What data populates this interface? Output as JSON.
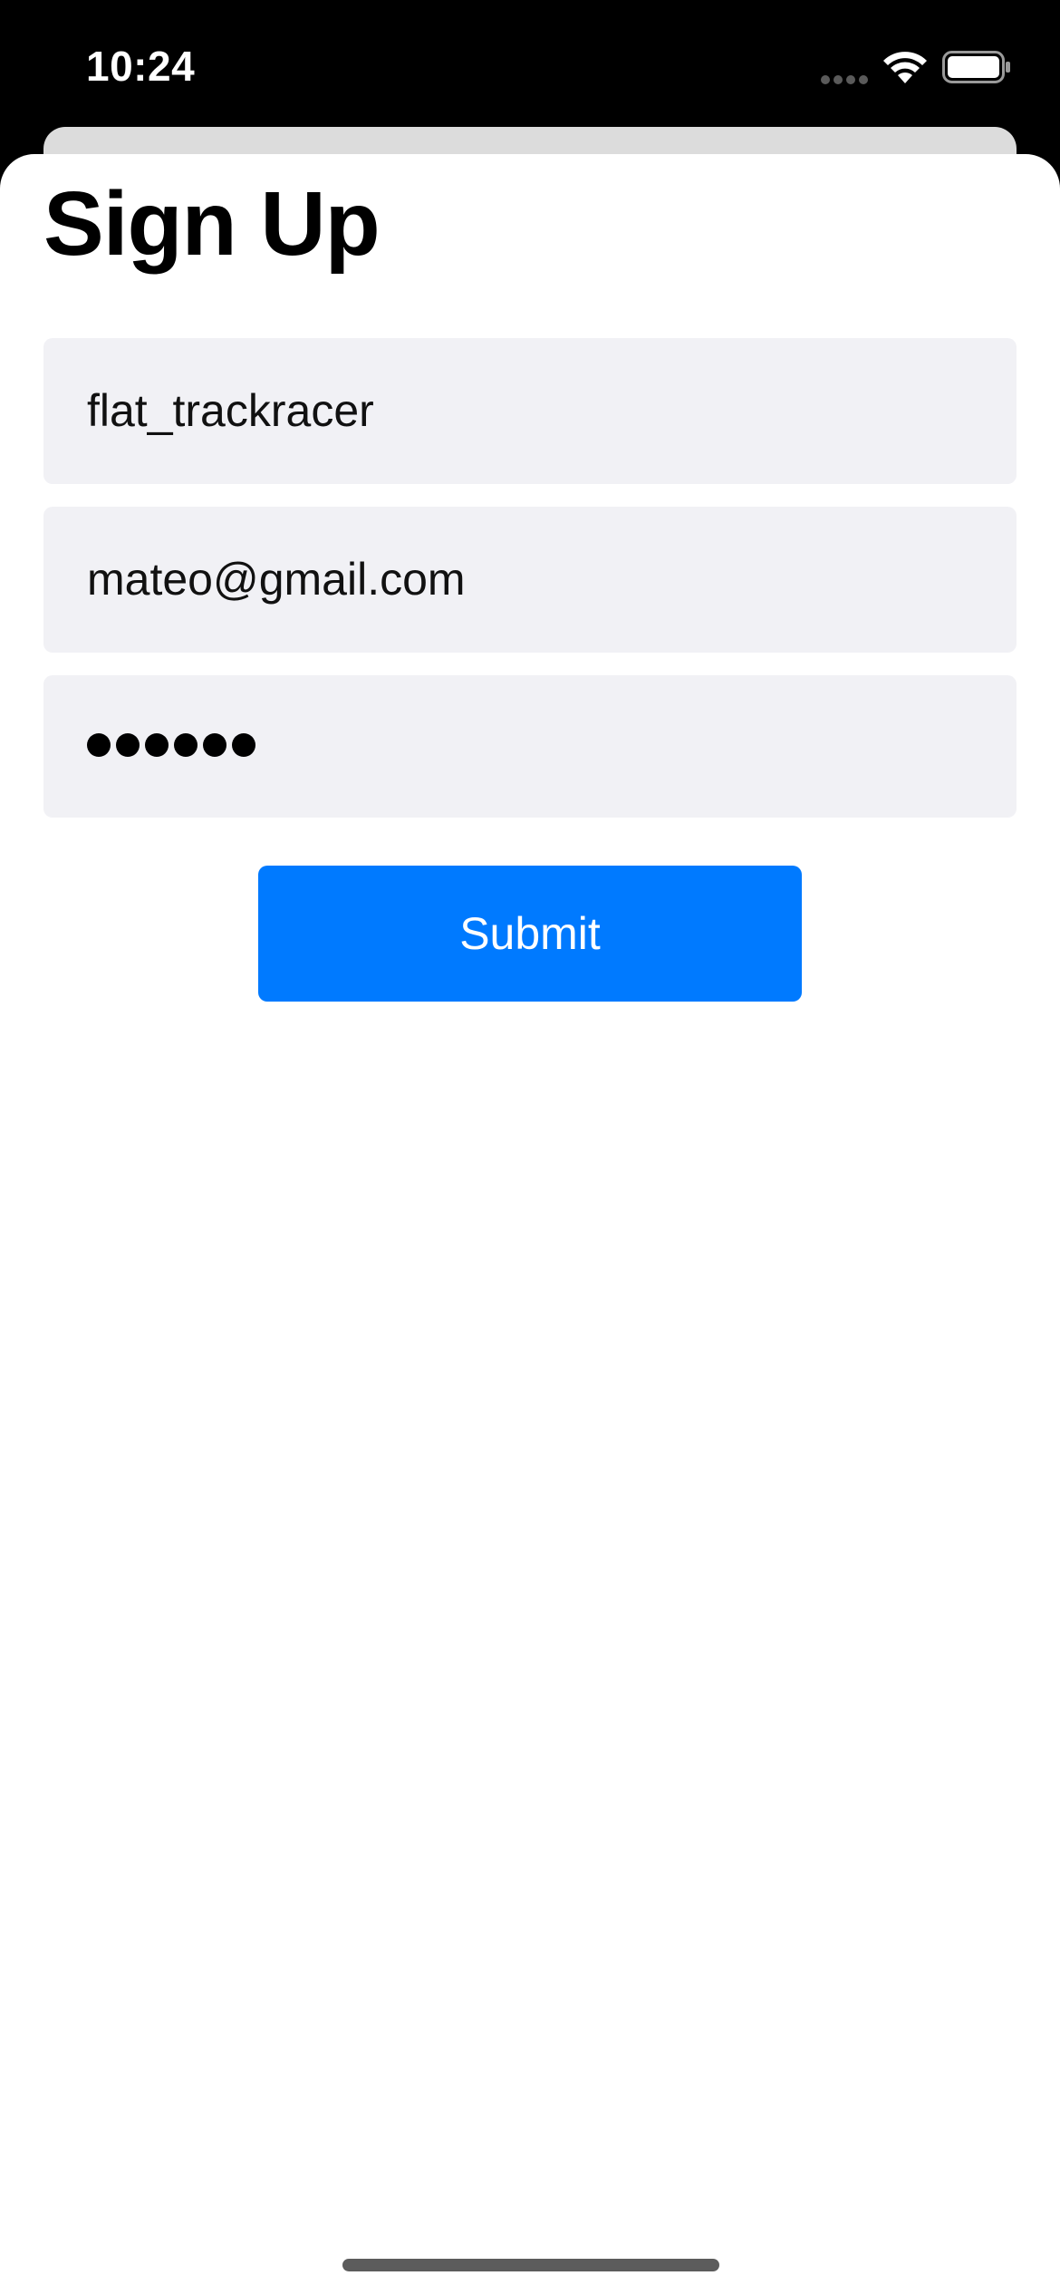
{
  "status_bar": {
    "time": "10:24",
    "icons": [
      "cellular-signal-icon",
      "wifi-icon",
      "battery-icon"
    ]
  },
  "page": {
    "title": "Sign Up"
  },
  "form": {
    "username_value": "flat_trackracer",
    "email_value": "mateo@gmail.com",
    "password_masked": "••••••",
    "password_length": 6,
    "submit_label": "Submit"
  },
  "colors": {
    "accent": "#007aff",
    "field_background": "#f1f1f5",
    "status_bar_background": "#000000",
    "sheet_background": "#ffffff"
  }
}
